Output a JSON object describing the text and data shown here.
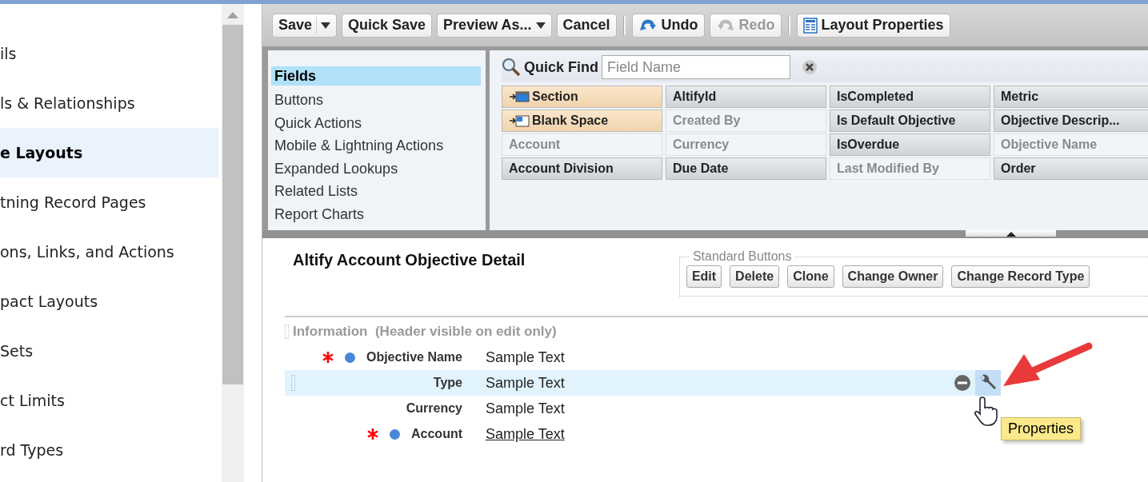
{
  "sidebar": {
    "items": [
      {
        "label": "ils",
        "selected": false
      },
      {
        "label": "ls & Relationships",
        "selected": false
      },
      {
        "label": "e Layouts",
        "selected": true
      },
      {
        "label": "tning Record Pages",
        "selected": false
      },
      {
        "label": "ons, Links, and Actions",
        "selected": false
      },
      {
        "label": "pact Layouts",
        "selected": false
      },
      {
        "label": "Sets",
        "selected": false
      },
      {
        "label": "ct Limits",
        "selected": false
      },
      {
        "label": "rd Types",
        "selected": false
      }
    ]
  },
  "toolbar": {
    "groups": [
      [
        {
          "label": "Save",
          "kind": "split",
          "disabled": false
        },
        {
          "label": "Quick Save",
          "kind": "plain",
          "disabled": false
        },
        {
          "label": "Preview As...",
          "kind": "menu",
          "disabled": false
        },
        {
          "label": "Cancel",
          "kind": "plain",
          "disabled": false
        }
      ],
      [
        {
          "label": "Undo",
          "kind": "undo",
          "disabled": false
        },
        {
          "label": "Redo",
          "kind": "redo",
          "disabled": true
        }
      ],
      [
        {
          "label": "Layout Properties",
          "kind": "layout",
          "disabled": false
        }
      ]
    ]
  },
  "palette": {
    "categories": [
      {
        "label": "Fields",
        "selected": true
      },
      {
        "label": "Buttons",
        "selected": false
      },
      {
        "label": "Quick Actions",
        "selected": false
      },
      {
        "label": "Mobile & Lightning Actions",
        "selected": false
      },
      {
        "label": "Expanded Lookups",
        "selected": false
      },
      {
        "label": "Related Lists",
        "selected": false
      },
      {
        "label": "Report Charts",
        "selected": false
      }
    ],
    "quick_find": {
      "label": "Quick Find",
      "placeholder": "Field Name"
    },
    "fields": [
      {
        "label": "Section",
        "kind": "section"
      },
      {
        "label": "AltifyId",
        "kind": "available"
      },
      {
        "label": "IsCompleted",
        "kind": "available"
      },
      {
        "label": "Metric",
        "kind": "available"
      },
      {
        "label": "Blank Space",
        "kind": "blank"
      },
      {
        "label": "Created By",
        "kind": "used"
      },
      {
        "label": "Is Default Objective",
        "kind": "available"
      },
      {
        "label": "Objective Descrip...",
        "kind": "available"
      },
      {
        "label": "Account",
        "kind": "used"
      },
      {
        "label": "Currency",
        "kind": "used"
      },
      {
        "label": "IsOverdue",
        "kind": "available"
      },
      {
        "label": "Objective Name",
        "kind": "used"
      },
      {
        "label": "Account Division",
        "kind": "available"
      },
      {
        "label": "Due Date",
        "kind": "available"
      },
      {
        "label": "Last Modified By",
        "kind": "used"
      },
      {
        "label": "Order",
        "kind": "available"
      }
    ]
  },
  "layout": {
    "title": "Altify Account Objective Detail",
    "standard_buttons": {
      "legend": "Standard Buttons",
      "buttons": [
        "Edit",
        "Delete",
        "Clone",
        "Change Owner",
        "Change Record Type"
      ]
    },
    "section": {
      "name": "Information",
      "note": "(Header visible on edit only)",
      "rows": [
        {
          "label": "Objective Name",
          "value": "Sample Text",
          "required": true,
          "link": false,
          "selected": false
        },
        {
          "label": "Type",
          "value": "Sample Text",
          "required": false,
          "link": false,
          "selected": true
        },
        {
          "label": "Currency",
          "value": "Sample Text",
          "required": false,
          "link": false,
          "selected": false
        },
        {
          "label": "Account",
          "value": "Sample Text",
          "required": true,
          "link": true,
          "selected": false
        }
      ]
    },
    "tooltip": "Properties"
  }
}
